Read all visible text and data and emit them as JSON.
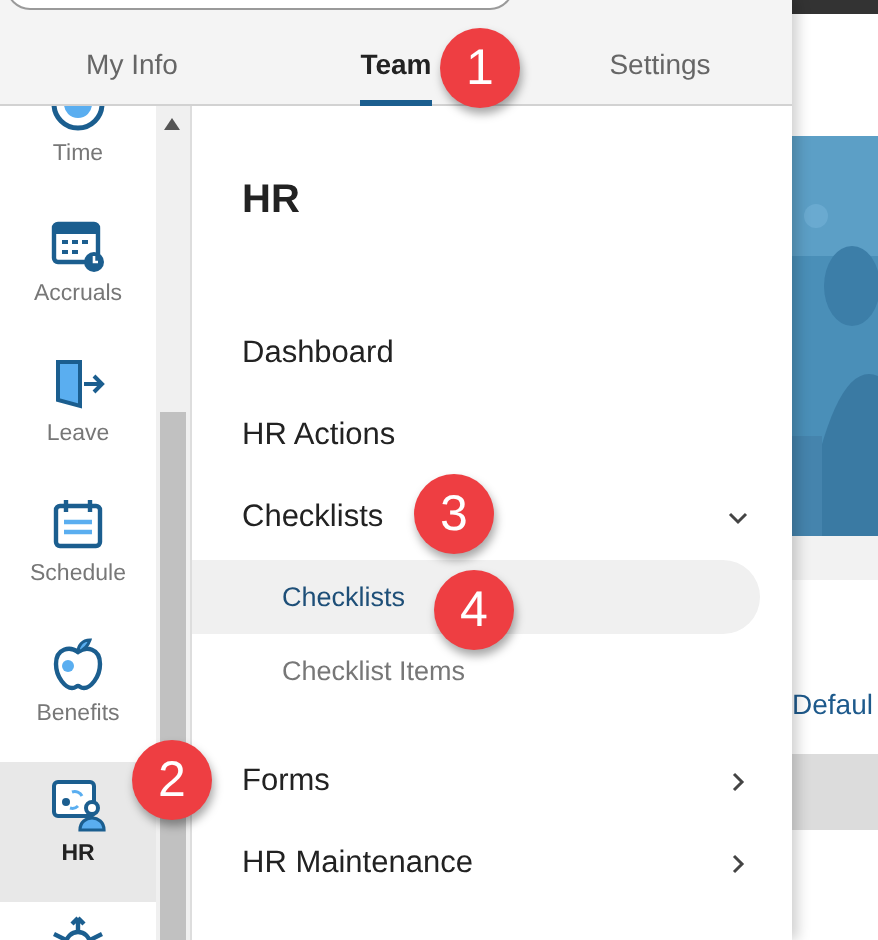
{
  "tabs": [
    {
      "label": "My Info",
      "selected": false
    },
    {
      "label": "Team",
      "selected": true
    },
    {
      "label": "Settings",
      "selected": false
    }
  ],
  "rail": [
    {
      "label": "Time",
      "selected": false
    },
    {
      "label": "Accruals",
      "selected": false
    },
    {
      "label": "Leave",
      "selected": false
    },
    {
      "label": "Schedule",
      "selected": false
    },
    {
      "label": "Benefits",
      "selected": false
    },
    {
      "label": "HR",
      "selected": true
    }
  ],
  "menu": {
    "title": "HR",
    "items": [
      {
        "label": "Dashboard"
      },
      {
        "label": "HR Actions"
      },
      {
        "label": "Checklists",
        "expanded": true,
        "children": [
          {
            "label": "Checklists",
            "selected": true
          },
          {
            "label": "Checklist Items",
            "selected": false
          }
        ]
      },
      {
        "label": "Forms",
        "expanded": false
      },
      {
        "label": "HR Maintenance",
        "expanded": false
      }
    ]
  },
  "badges": [
    "1",
    "2",
    "3",
    "4"
  ],
  "background": {
    "link": "Defaul"
  }
}
